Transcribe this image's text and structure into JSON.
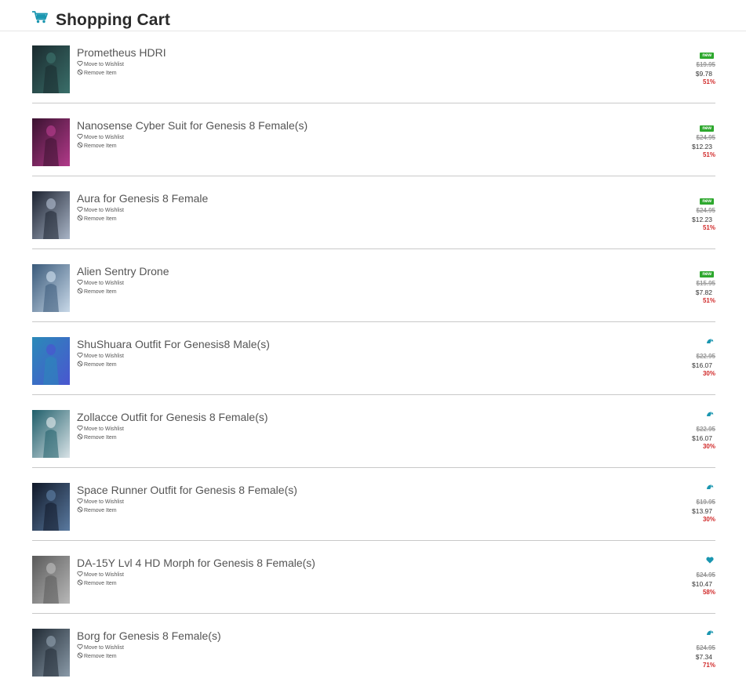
{
  "header": {
    "title": "Shopping Cart",
    "icon": "cart-icon",
    "accent": "#1a96b0"
  },
  "actions": {
    "wishlist_label": "Move to Wishlist",
    "remove_label": "Remove Item"
  },
  "colors": {
    "new_badge": "#2ea82e",
    "discount": "#d12a2a",
    "divider": "#c9c9c9"
  },
  "items": [
    {
      "name": "Prometheus HDRI",
      "badge": "new",
      "orig_price": "$19.95",
      "price": "$9.78",
      "discount": "51%",
      "thumb": [
        "#1a2a2e",
        "#3a6f6a"
      ]
    },
    {
      "name": "Nanosense Cyber Suit for Genesis 8 Female(s)",
      "badge": "new",
      "orig_price": "$24.95",
      "price": "$12.23",
      "discount": "51%",
      "thumb": [
        "#3a1230",
        "#b23a8a"
      ]
    },
    {
      "name": "Aura for Genesis 8 Female",
      "badge": "new",
      "orig_price": "$24.95",
      "price": "$12.23",
      "discount": "51%",
      "thumb": [
        "#1c2230",
        "#a8b4c6"
      ]
    },
    {
      "name": "Alien Sentry Drone",
      "badge": "new",
      "orig_price": "$15.95",
      "price": "$7.82",
      "discount": "51%",
      "thumb": [
        "#3a5a7a",
        "#c8d8e8"
      ]
    },
    {
      "name": "ShuShuara Outfit For Genesis8 Male(s)",
      "badge": "pc-icon",
      "orig_price": "$22.95",
      "price": "$16.07",
      "discount": "30%",
      "thumb": [
        "#2a8ab8",
        "#4a56d0"
      ]
    },
    {
      "name": "Zollacce Outfit for Genesis 8 Female(s)",
      "badge": "pc-icon",
      "orig_price": "$22.95",
      "price": "$16.07",
      "discount": "30%",
      "thumb": [
        "#1f5e6a",
        "#d8e2e6"
      ]
    },
    {
      "name": "Space Runner Outfit for Genesis 8 Female(s)",
      "badge": "pc-icon",
      "orig_price": "$19.95",
      "price": "$13.97",
      "discount": "30%",
      "thumb": [
        "#101828",
        "#5a7aa0"
      ]
    },
    {
      "name": "DA-15Y Lvl 4 HD Morph for Genesis 8 Female(s)",
      "badge": "heart-icon",
      "orig_price": "$24.95",
      "price": "$10.47",
      "discount": "58%",
      "thumb": [
        "#5a5a5a",
        "#b8b8b8"
      ]
    },
    {
      "name": "Borg for Genesis 8 Female(s)",
      "badge": "pc-icon",
      "orig_price": "$24.95",
      "price": "$7.34",
      "discount": "71%",
      "thumb": [
        "#202a34",
        "#8a9aa8"
      ]
    }
  ]
}
